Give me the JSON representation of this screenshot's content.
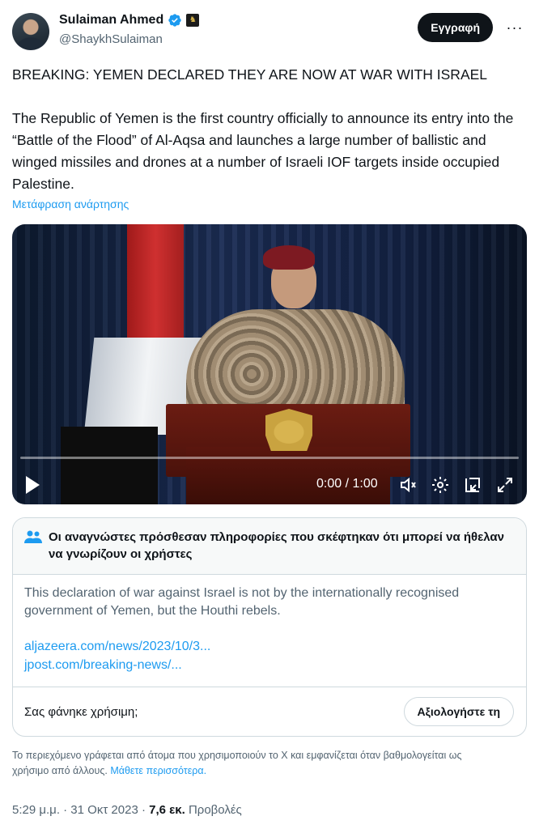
{
  "user": {
    "display_name": "Sulaiman Ahmed",
    "handle": "@ShaykhSulaiman",
    "verified": true
  },
  "actions": {
    "follow_label": "Εγγραφή",
    "more_label": "···"
  },
  "tweet": {
    "paragraph1": "BREAKING: YEMEN DECLARED THEY ARE NOW AT WAR WITH ISRAEL",
    "paragraph2": "The Republic of Yemen is the first country officially to announce its entry into the “Battle of the Flood” of Al-Aqsa and launches a large number of ballistic and winged missiles and drones at a number of Israeli IOF targets inside occupied Palestine.",
    "translate_label": "Μετάφραση ανάρτησης"
  },
  "video": {
    "time": "0:00 / 1:00",
    "progress": 0
  },
  "community_note": {
    "title": "Οι αναγνώστες πρόσθεσαν πληροφορίες που σκέφτηκαν ότι μπορεί να ήθελαν να γνωρίζουν οι χρήστες",
    "body": "This declaration of war against Israel is not by the  internationally recognised government of Yemen, but the Houthi rebels.",
    "links": [
      "aljazeera.com/news/2023/10/3...",
      "jpost.com/breaking-news/..."
    ],
    "question": "Σας φάνηκε χρήσιμη;",
    "rate_label": "Αξιολογήστε τη"
  },
  "disclaimer": {
    "text": "Το περιεχόμενο γράφεται από άτομα που χρησιμοποιούν το X και εμφανίζεται όταν βαθμολογείται ως χρήσιμο από άλλους.",
    "learn_more": "Μάθετε περισσότερα."
  },
  "meta": {
    "timestamp": "5:29 μ.μ. · 31 Οκτ 2023 · ",
    "views_count": "7,6 εκ.",
    "views_label": "Προβολές"
  },
  "colors": {
    "accent": "#1d9bf0",
    "verified": "#1d9bf0",
    "text_primary": "#0f1419",
    "text_secondary": "#536471"
  }
}
